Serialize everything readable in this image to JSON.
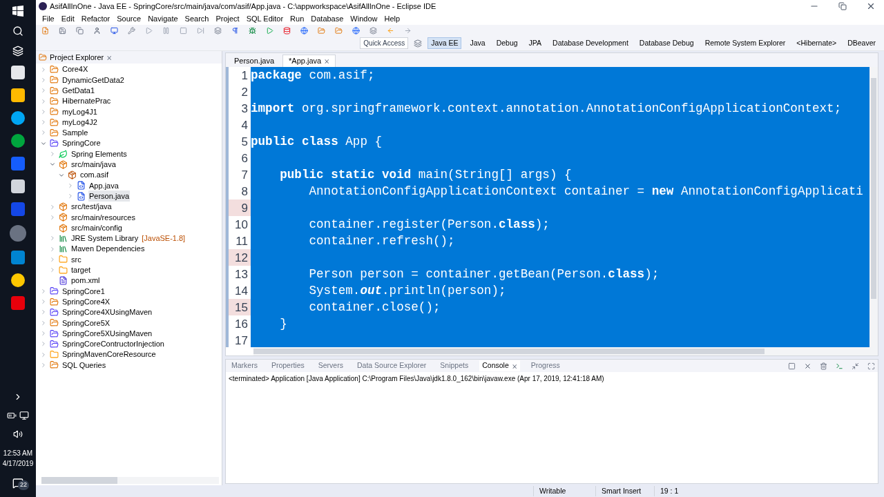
{
  "window": {
    "title": "AsifAllInOne - Java EE - SpringCore/src/main/java/com/asif/App.java - C:\\appworkspace\\AsifAllInOne - Eclipse IDE"
  },
  "menu": [
    "File",
    "Edit",
    "Refactor",
    "Source",
    "Navigate",
    "Search",
    "Project",
    "SQL Editor",
    "Run",
    "Database",
    "Window",
    "Help"
  ],
  "quick_access": {
    "placeholder": "Quick Access"
  },
  "perspectives": [
    {
      "label": "Java EE",
      "selected": true
    },
    {
      "label": "Java",
      "selected": false
    },
    {
      "label": "Debug",
      "selected": false
    },
    {
      "label": "JPA",
      "selected": false
    },
    {
      "label": "Database Development",
      "selected": false
    },
    {
      "label": "Database Debug",
      "selected": false
    },
    {
      "label": "Remote System Explorer",
      "selected": false
    },
    {
      "label": "<Hibernate>",
      "selected": false
    },
    {
      "label": "DBeaver",
      "selected": false
    }
  ],
  "project_explorer": {
    "title": "Project Explorer",
    "close": "⨯",
    "items": [
      {
        "label": "Core4X",
        "kind": "project",
        "expanded": false,
        "selected": false
      },
      {
        "label": "DynamicGetData2",
        "kind": "project",
        "expanded": false,
        "selected": false
      },
      {
        "label": "GetData1",
        "kind": "project",
        "expanded": false,
        "selected": false
      },
      {
        "label": "HibernatePrac",
        "kind": "project",
        "expanded": false,
        "selected": false
      },
      {
        "label": "myLog4J1",
        "kind": "project",
        "expanded": false,
        "selected": false
      },
      {
        "label": "myLog4J2",
        "kind": "project",
        "expanded": false,
        "selected": false
      },
      {
        "label": "Sample",
        "kind": "project",
        "expanded": false,
        "selected": false
      },
      {
        "label": "SpringCore",
        "kind": "maven",
        "expanded": true,
        "selected": false,
        "children": [
          {
            "label": "Spring Elements",
            "kind": "spring",
            "expanded": false,
            "selected": false
          },
          {
            "label": "src/main/java",
            "kind": "source",
            "expanded": true,
            "selected": false,
            "children": [
              {
                "label": "com.asif",
                "kind": "package",
                "expanded": true,
                "selected": false,
                "children": [
                  {
                    "label": "App.java",
                    "kind": "file",
                    "expanded": false,
                    "selected": false
                  },
                  {
                    "label": "Person.java",
                    "kind": "file",
                    "expanded": false,
                    "selected": true
                  }
                ]
              }
            ]
          },
          {
            "label": "src/test/java",
            "kind": "source",
            "expanded": false,
            "selected": false
          },
          {
            "label": "src/main/resources",
            "kind": "source",
            "expanded": false,
            "selected": false
          },
          {
            "label": "src/main/config",
            "kind": "source",
            "selected": false
          },
          {
            "label": "JRE System Library",
            "decoration": "[JavaSE-1.8]",
            "kind": "library",
            "expanded": false,
            "selected": false
          },
          {
            "label": "Maven Dependencies",
            "kind": "library",
            "expanded": false,
            "selected": false
          },
          {
            "label": "src",
            "kind": "folder",
            "expanded": false,
            "selected": false
          },
          {
            "label": "target",
            "kind": "folder",
            "expanded": false,
            "selected": false
          },
          {
            "label": "pom.xml",
            "kind": "xml",
            "selected": false
          }
        ]
      },
      {
        "label": "SpringCore1",
        "kind": "maven",
        "expanded": false,
        "selected": false
      },
      {
        "label": "SpringCore4X",
        "kind": "project",
        "expanded": false,
        "selected": false
      },
      {
        "label": "SpringCore4XUsingMaven",
        "kind": "maven",
        "expanded": false,
        "selected": false
      },
      {
        "label": "SpringCore5X",
        "kind": "project",
        "expanded": false,
        "selected": false
      },
      {
        "label": "SpringCore5XUsingMaven",
        "kind": "maven",
        "expanded": false,
        "selected": false
      },
      {
        "label": "SpringCoreContructorInjection",
        "kind": "maven",
        "expanded": false,
        "selected": false
      },
      {
        "label": "SpringMavenCoreResource",
        "kind": "folder",
        "expanded": false,
        "selected": false
      },
      {
        "label": "SQL Queries",
        "kind": "project",
        "expanded": false,
        "selected": false
      }
    ]
  },
  "editor": {
    "tabs": [
      {
        "label": "Person.java",
        "selected": false
      },
      {
        "label": "*App.java",
        "selected": true,
        "close": "⨯"
      }
    ],
    "lines": [
      {
        "number": "1",
        "changed": false,
        "code": "**package** com.asif;"
      },
      {
        "number": "2",
        "changed": false
      },
      {
        "number": "3",
        "changed": false,
        "code": "**import** org.springframework.context.annotation.AnnotationConfigApplicationContext;"
      },
      {
        "number": "4",
        "changed": false
      },
      {
        "number": "5",
        "changed": false,
        "code": "**public class** App {"
      },
      {
        "number": "6",
        "changed": false
      },
      {
        "number": "7",
        "changed": false,
        "code": "    **public static void** main(String[] args) {"
      },
      {
        "number": "8",
        "changed": false,
        "code": "        AnnotationConfigApplicationContext container = **new** AnnotationConfigApplicati"
      },
      {
        "number": "9",
        "changed": true
      },
      {
        "number": "10",
        "changed": false,
        "code": "        container.register(Person.**class**);"
      },
      {
        "number": "11",
        "changed": false,
        "code": "        container.refresh();"
      },
      {
        "number": "12",
        "changed": true
      },
      {
        "number": "13",
        "changed": false,
        "code": "        Person person = container.getBean(Person.**class**);"
      },
      {
        "number": "14",
        "changed": false,
        "code": "        System.*out*.println(person);"
      },
      {
        "number": "15",
        "changed": true,
        "code": "        container.close();"
      },
      {
        "number": "16",
        "changed": false,
        "code": "    }"
      },
      {
        "number": "17",
        "changed": false
      }
    ]
  },
  "bottom_panel": {
    "tabs": [
      {
        "label": "Markers",
        "selected": false
      },
      {
        "label": "Properties",
        "selected": false
      },
      {
        "label": "Servers",
        "selected": false
      },
      {
        "label": "Data Source Explorer",
        "selected": false
      },
      {
        "label": "Snippets",
        "selected": false
      },
      {
        "label": "Console",
        "selected": true,
        "close": "⨯"
      },
      {
        "label": "Progress",
        "selected": false
      }
    ],
    "console_header": "<terminated> Application [Java Application] C:\\Program Files\\Java\\jdk1.8.0_162\\bin\\javaw.exe (Apr 17, 2019, 12:41:18 AM)"
  },
  "status_bar": {
    "writable": "Writable",
    "insert_mode": "Smart Insert",
    "position": "19 : 1"
  },
  "taskbar": {
    "time": "12:53 AM",
    "date": "4/17/2019",
    "notifications": "22"
  }
}
